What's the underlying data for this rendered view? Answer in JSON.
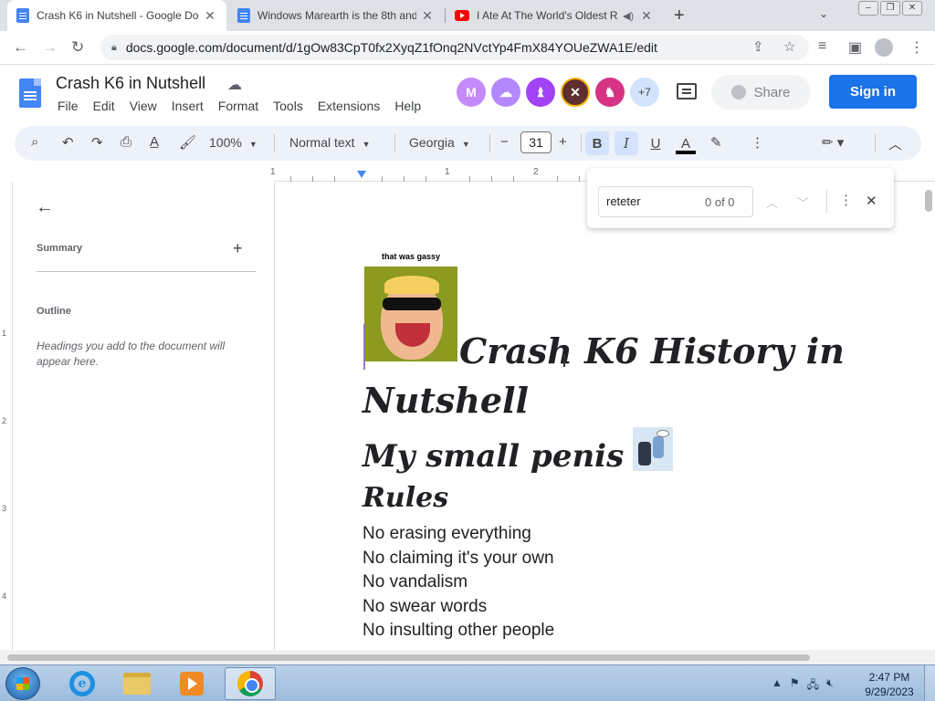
{
  "browser": {
    "tabs": [
      {
        "title": "Crash K6 in Nutshell - Google Docs",
        "favicon": "google-docs-icon",
        "active": true
      },
      {
        "title": "Windows Marearth is the 8th and",
        "favicon": "google-docs-icon",
        "active": false
      },
      {
        "title": "I Ate At The World's Oldest R",
        "favicon": "youtube-icon",
        "active": false
      }
    ],
    "url": "docs.google.com/document/d/1gOw83CpT0fx2XyqZ1fOnq2NVctYp4FmX84YOUeZWA1E/edit"
  },
  "docs": {
    "title": "Crash K6 in Nutshell",
    "menu": [
      "File",
      "Edit",
      "View",
      "Insert",
      "Format",
      "Tools",
      "Extensions",
      "Help"
    ],
    "avatar_colors": [
      "#c58af9",
      "#b388ff",
      "#a142f4",
      "#5f2e2e",
      "#d63384"
    ],
    "more_collaborators": "+7",
    "share_label": "Share",
    "signin_label": "Sign in",
    "accent_color": "#1a73e8"
  },
  "format_toolbar": {
    "zoom": "100%",
    "style": "Normal text",
    "font": "Georgia",
    "font_size": "31",
    "bold_label": "B",
    "italic_label": "I",
    "underline_label": "U",
    "textcolor_label": "A"
  },
  "ruler": {
    "labels": [
      "1",
      "1",
      "2"
    ],
    "vertical_labels": [
      "1",
      "2",
      "3",
      "4"
    ]
  },
  "sidebar": {
    "summary_label": "Summary",
    "outline_label": "Outline",
    "outline_hint": "Headings you add to the document will appear here."
  },
  "find": {
    "query": "reteter",
    "count": "0 of 0"
  },
  "document": {
    "image1_caption": "that was gassy",
    "title": "Crash K6 History in Nutshell",
    "subtitle": "My small penis",
    "rules_heading": "Rules",
    "rules": [
      "No erasing everything",
      "No claiming it's your own",
      "No vandalism",
      "No swear words",
      "No insulting other people"
    ]
  },
  "taskbar": {
    "time": "2:47 PM",
    "date": "9/29/2023"
  }
}
